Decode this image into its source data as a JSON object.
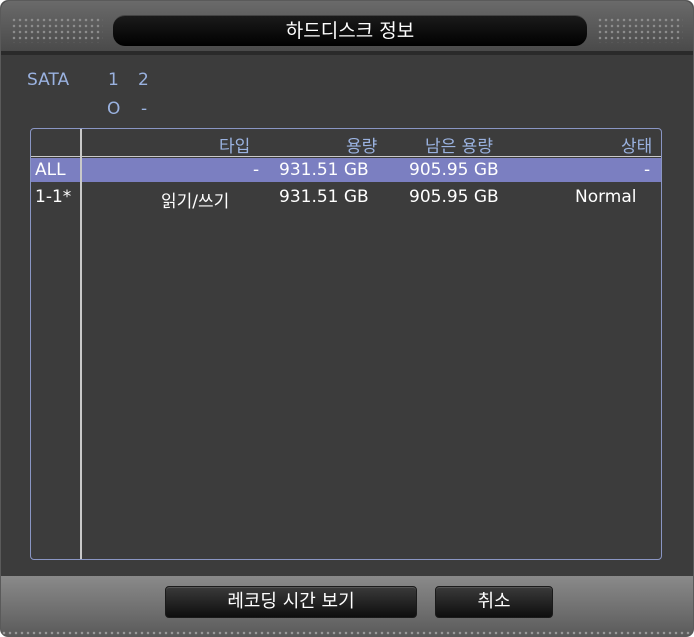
{
  "window": {
    "title": "하드디스크 정보"
  },
  "sata": {
    "label": "SATA",
    "ports": [
      "1",
      "2"
    ],
    "status": [
      "O",
      "-"
    ]
  },
  "table": {
    "columns": [
      "타입",
      "용량",
      "남은 용량",
      "상태"
    ],
    "rows": [
      {
        "id": "ALL",
        "type": "-",
        "capacity": "931.51 GB",
        "remaining": "905.95 GB",
        "status": "-",
        "selected": true
      },
      {
        "id": "1-1*",
        "type": "읽기/쓰기",
        "capacity": "931.51 GB",
        "remaining": "905.95 GB",
        "status": "Normal",
        "selected": false
      }
    ]
  },
  "buttons": {
    "record_time": "레코딩 시간 보기",
    "cancel": "취소"
  },
  "colors": {
    "background": "#3c3c3c",
    "accent_text": "#9ab2e0",
    "selected_row": "#7b7fc1"
  }
}
